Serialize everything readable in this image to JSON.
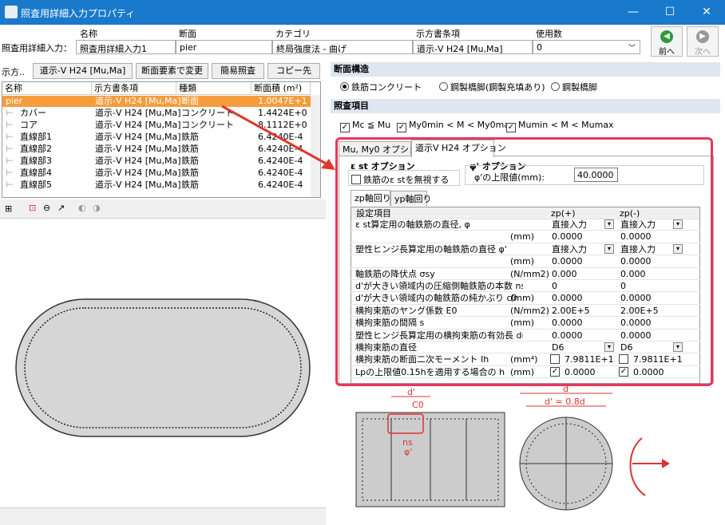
{
  "window": {
    "title": "照査用詳細入力プロパティ",
    "min": "—",
    "max": "☐",
    "close": "✕"
  },
  "header": {
    "row_label": "照査用詳細入力：",
    "cols": [
      {
        "label": "名称",
        "value": "照査用詳細入力1"
      },
      {
        "label": "断面",
        "value": "pier"
      },
      {
        "label": "カテゴリ",
        "value": "終局強度法 - 曲げ"
      },
      {
        "label": "示方書条項",
        "value": "道示-V H24 [Mu,Ma]"
      },
      {
        "label": "使用数",
        "value": "0"
      }
    ],
    "prev": "前へ",
    "next": "次へ"
  },
  "left": {
    "toolbar": {
      "label": "示方..",
      "btn1": "道示-V H24 [Mu,Ma]",
      "btn2": "断面要素で変更",
      "btn3": "簡易照査",
      "btn4": "コピー先"
    },
    "grid": {
      "columns": [
        "名称",
        "示方書条項",
        "種類",
        "断面積 (m²)"
      ],
      "rows": [
        [
          "pier",
          "道示-V H24 [Mu,Ma]",
          "断面",
          "1.0047E+1"
        ],
        [
          "カバー",
          "道示-V H24 [Mu,Ma]",
          "コンクリート",
          "1.4424E+0"
        ],
        [
          "コア",
          "道示-V H24 [Mu,Ma]",
          "コンクリート",
          "8.1112E+0"
        ],
        [
          "直線部1",
          "道示-V H24 [Mu,Ma]",
          "鉄筋",
          "6.4240E-4"
        ],
        [
          "直線部2",
          "道示-V H24 [Mu,Ma]",
          "鉄筋",
          "6.4240E-4"
        ],
        [
          "直線部3",
          "道示-V H24 [Mu,Ma]",
          "鉄筋",
          "6.4240E-4"
        ],
        [
          "直線部4",
          "道示-V H24 [Mu,Ma]",
          "鉄筋",
          "6.4240E-4"
        ],
        [
          "直線部5",
          "道示-V H24 [Mu,Ma]",
          "鉄筋",
          "6.4240E-4"
        ]
      ]
    }
  },
  "right": {
    "section1": "断面構造",
    "radios": [
      "鉄筋コンクリート",
      "鋼製橋脚(鋼製充填あり)",
      "鋼製橋脚"
    ],
    "section2": "照査項目",
    "checks": [
      "Mc ≦ Mu",
      "My0min < M < My0max",
      "Mumin < M < Mumax"
    ],
    "tabs": [
      "Mu, My0 オプション",
      "道示V H24 オプション"
    ],
    "eps_title": "ε st オプション",
    "eps_check": "鉄筋のε stを無視する",
    "phi_title": "φ' オプション",
    "phi_label": "φ'の上限値(mm):",
    "phi_value": "40.0000",
    "subtabs": [
      "zp軸回り",
      "yp軸回り"
    ],
    "table": {
      "headers": [
        "設定項目",
        "",
        "zp(+)",
        "zp(-)"
      ],
      "rows": [
        [
          "ε st算定用の軸鉄筋の直径, φ",
          "",
          "直接入力",
          "直接入力"
        ],
        [
          "",
          "(mm)",
          "0.0000",
          "0.0000"
        ],
        [
          "塑性ヒンジ長算定用の軸鉄筋の直径 φ'",
          "",
          "直接入力",
          "直接入力"
        ],
        [
          "",
          "(mm)",
          "0.0000",
          "0.0000"
        ],
        [
          "軸鉄筋の降伏点 σsy",
          "(N/mm2)",
          "0.000",
          "0.000"
        ],
        [
          "d'が大きい領域内の圧縮側軸鉄筋の本数 ns",
          "",
          "0",
          "0"
        ],
        [
          "d'が大きい領域内の軸鉄筋の純かぶり c0",
          "(mm)",
          "0.0000",
          "0.0000"
        ],
        [
          "横拘束筋のヤング係数 E0",
          "(N/mm2)",
          "2.00E+5",
          "2.00E+5"
        ],
        [
          "横拘束筋の間隔 s",
          "(mm)",
          "0.0000",
          "0.0000"
        ],
        [
          "塑性ヒンジ長算定用の横拘束筋の有効長 d(mm)",
          "",
          "0.0000",
          "0.0000"
        ],
        [
          "横拘束筋の直径",
          "",
          "D6",
          "D6"
        ],
        [
          "横拘束筋の断面二次モーメント Ih",
          "(mm⁴)",
          "7.9811E+1",
          "7.9811E+1"
        ],
        [
          "Lpの上限値0.15hを適用する場合の h",
          "(mm)",
          "0.0000",
          "0.0000"
        ]
      ]
    },
    "diagram": {
      "d_prime": "d'",
      "c0": "C0",
      "ns": "ns",
      "phi": "φ'",
      "d": "d",
      "d_eq": "d' = 0.8d"
    }
  }
}
